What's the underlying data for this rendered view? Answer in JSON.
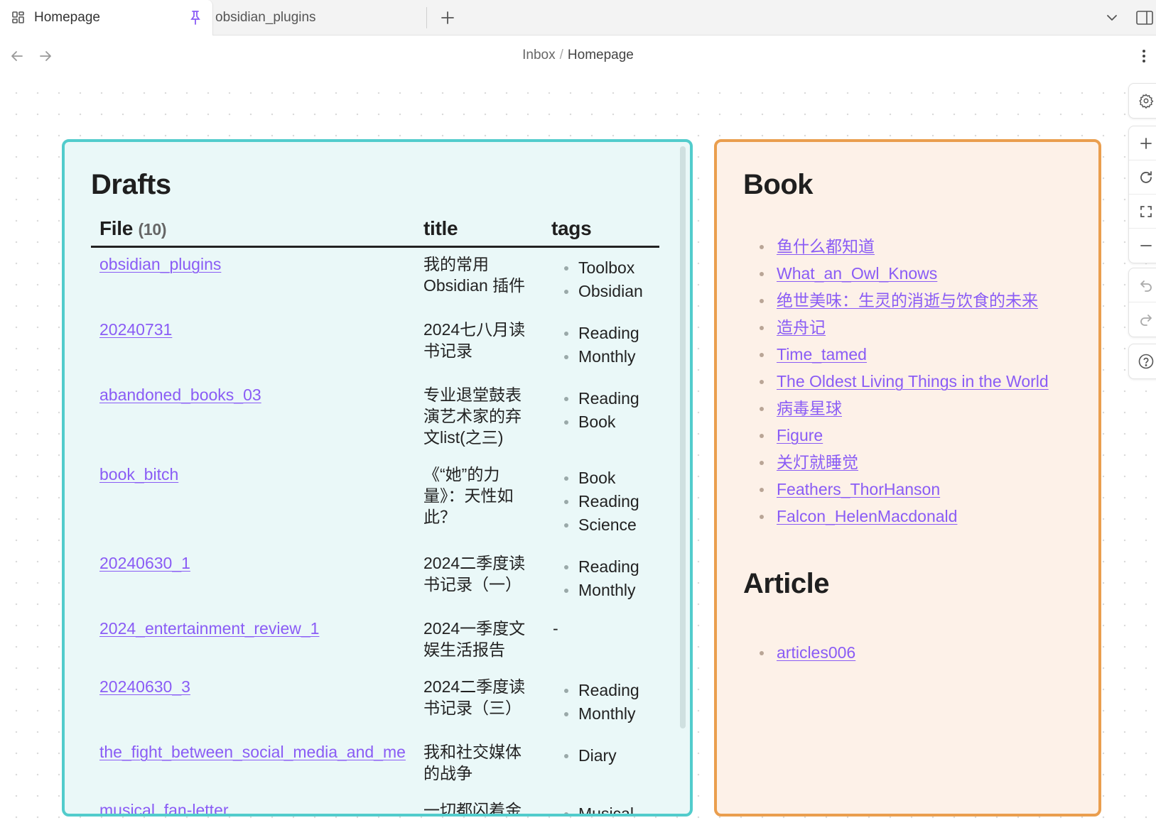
{
  "tabs": [
    {
      "label": "Homepage",
      "active": true
    },
    {
      "label": "obsidian_plugins",
      "active": false
    }
  ],
  "breadcrumb": {
    "parent": "Inbox",
    "separator": "/",
    "current": "Homepage"
  },
  "colors": {
    "drafts_border": "#52cccc",
    "drafts_bg": "#eaf8f8",
    "book_border": "#ea9e4e",
    "book_bg": "#fdf1e8",
    "link": "#8a5cf5"
  },
  "drafts": {
    "title": "Drafts",
    "headers": {
      "file": "File",
      "file_count": "(10)",
      "title": "title",
      "tags": "tags"
    },
    "rows": [
      {
        "file": "obsidian_plugins",
        "title": "我的常用 Obsidian 插件",
        "tags": [
          "Toolbox",
          "Obsidian"
        ]
      },
      {
        "file": "20240731",
        "title": "2024七八月读书记录",
        "tags": [
          "Reading",
          "Monthly"
        ]
      },
      {
        "file": "abandoned_books_03",
        "title": "专业退堂鼓表演艺术家的弃文list(之三)",
        "tags": [
          "Reading",
          "Book"
        ]
      },
      {
        "file": "book_bitch",
        "title": "《“她”的力量》：天性如此？",
        "tags": [
          "Book",
          "Reading",
          "Science"
        ]
      },
      {
        "file": "20240630_1",
        "title": "2024二季度读书记录（一）",
        "tags": [
          "Reading",
          "Monthly"
        ]
      },
      {
        "file": "2024_entertainment_review_1",
        "title": "2024一季度文娱生活报告",
        "tags": [],
        "tags_placeholder": "-"
      },
      {
        "file": "20240630_3",
        "title": "2024二季度读书记录（三）",
        "tags": [
          "Reading",
          "Monthly"
        ]
      },
      {
        "file": "the_fight_between_social_media_and_me",
        "title": "我和社交媒体的战争",
        "tags": [
          "Diary"
        ]
      },
      {
        "file": "musical_fan-letter",
        "title": "一切都闪着金色的光",
        "tags": [
          "Musical"
        ]
      }
    ]
  },
  "book": {
    "title": "Book",
    "items": [
      "鱼什么都知道",
      "What_an_Owl_Knows",
      "绝世美味：生灵的消逝与饮食的未来",
      "造舟记",
      "Time_tamed",
      "The Oldest Living Things in the World",
      "病毒星球",
      "Figure",
      "关灯就睡觉",
      "Feathers_ThorHanson",
      "Falcon_HelenMacdonald"
    ]
  },
  "article": {
    "title": "Article",
    "items": [
      "articles006"
    ]
  },
  "icons": {
    "tab_icon": "grid-icon",
    "pin": "pin-icon",
    "add_tab": "plus-icon",
    "tab_list": "chevron-down-icon",
    "sidebar": "sidebar-toggle-icon",
    "back": "arrow-left-icon",
    "forward": "arrow-right-icon",
    "more": "more-vertical-icon",
    "settings": "gear-icon",
    "zoom_in": "plus-icon",
    "reset": "refresh-icon",
    "fit": "fullscreen-icon",
    "zoom_out": "minus-icon",
    "undo": "undo-icon",
    "redo": "redo-icon",
    "help": "help-icon"
  }
}
